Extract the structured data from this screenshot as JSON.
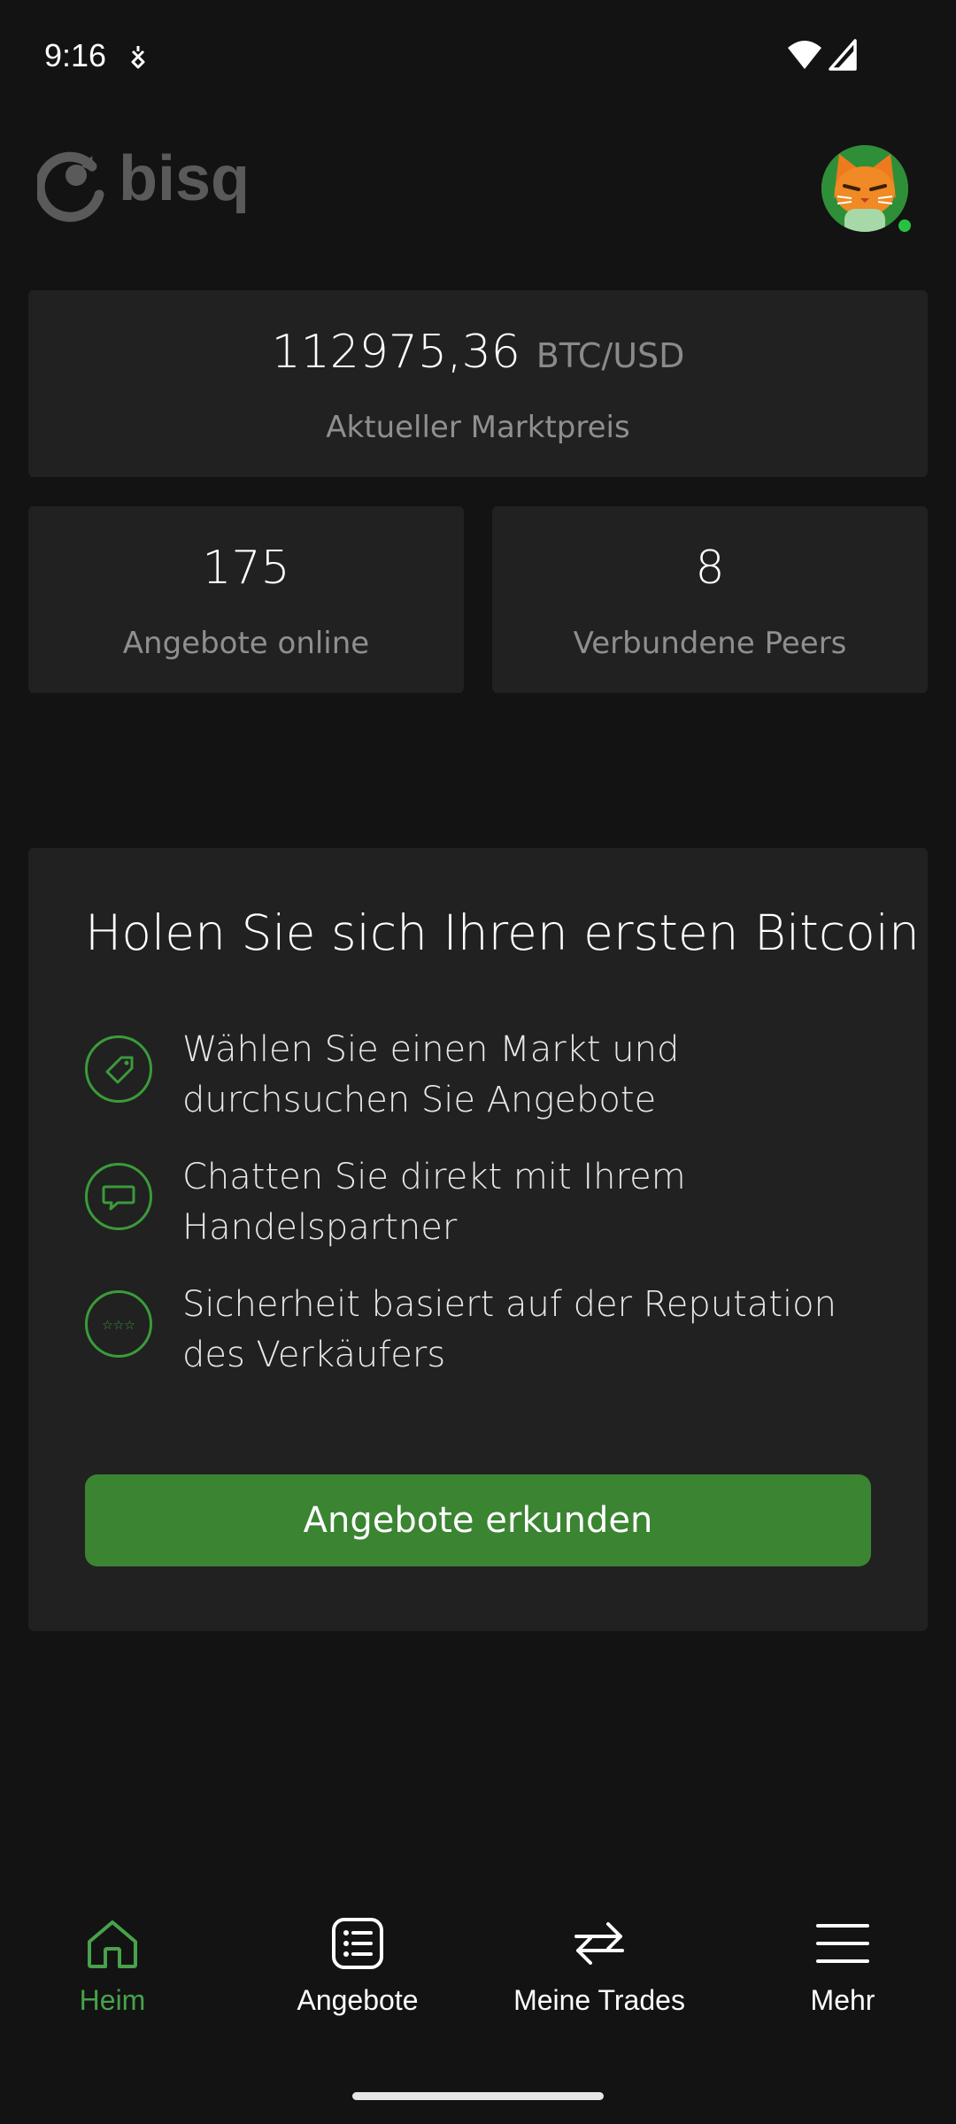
{
  "status_bar": {
    "time": "9:16",
    "icons": [
      "notification-icon",
      "wifi-icon",
      "signal-icon"
    ]
  },
  "header": {
    "logo_text": "bisq",
    "avatar": "cat-avatar",
    "online_status": "online"
  },
  "market": {
    "price": "112975,36",
    "pair": "BTC/USD",
    "label": "Aktueller Marktpreis"
  },
  "stats": {
    "offers_count": "175",
    "offers_label": "Angebote online",
    "peers_count": "8",
    "peers_label": "Verbundene Peers"
  },
  "intro": {
    "title": "Holen Sie sich Ihren ersten Bitcoin",
    "features": [
      {
        "icon": "tag-icon",
        "text": "Wählen Sie einen Markt und durchsuchen Sie Angebote"
      },
      {
        "icon": "chat-icon",
        "text": "Chatten Sie direkt mit Ihrem Handelspartner"
      },
      {
        "icon": "stars-icon",
        "text": "Sicherheit basiert auf der Reputation des Verkäufers"
      }
    ],
    "button_label": "Angebote erkunden"
  },
  "nav": {
    "items": [
      {
        "label": "Heim",
        "icon": "home-icon",
        "active": true
      },
      {
        "label": "Angebote",
        "icon": "list-icon",
        "active": false
      },
      {
        "label": "Meine Trades",
        "icon": "swap-icon",
        "active": false
      },
      {
        "label": "Mehr",
        "icon": "menu-icon",
        "active": false
      }
    ]
  },
  "colors": {
    "background": "#131313",
    "card": "#212121",
    "accent": "#3a8432",
    "accent_text": "#47a24a",
    "muted_text": "#8f8f8f"
  }
}
